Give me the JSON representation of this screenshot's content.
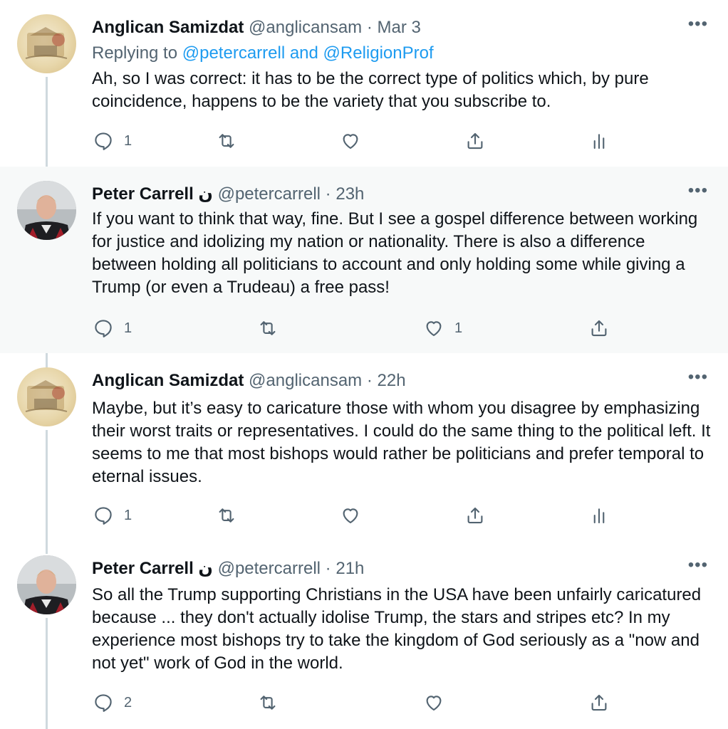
{
  "tweets": [
    {
      "name": "Anglican Samizdat",
      "handle": "@anglicansam",
      "dot": "·",
      "time": "Mar 3",
      "replying_prefix": "Replying to",
      "replying_link": "@petercarrell and @ReligionProf",
      "text": "Ah, so I was correct: it has to be the correct type of politics which, by pure coincidence, happens to be the variety that you subscribe to.",
      "reply_count": "1",
      "like_count": ""
    },
    {
      "name": "Peter Carrell",
      "name_suffix": "ن",
      "handle": "@petercarrell",
      "dot": "·",
      "time": "23h",
      "text": "If you want to think that way, fine. But I see a gospel difference between working for justice and idolizing my nation or nationality. There is also a difference between holding all politicians to account and only holding some while giving a Trump (or even a Trudeau) a free pass!",
      "reply_count": "1",
      "like_count": "1"
    },
    {
      "name": "Anglican Samizdat",
      "handle": "@anglicansam",
      "dot": "·",
      "time": "22h",
      "text": "Maybe, but it’s easy to caricature those with whom you disagree by emphasizing their worst traits or representatives. I could do the same thing to the political left. It seems to me that most bishops would rather be politicians and prefer temporal to eternal issues.",
      "reply_count": "1",
      "like_count": ""
    },
    {
      "name": "Peter Carrell",
      "name_suffix": "ن",
      "handle": "@petercarrell",
      "dot": "·",
      "time": "21h",
      "text": "So all the Trump supporting Christians in the USA have been unfairly caricatured because ... they don't actually idolise Trump, the stars and stripes etc? In my experience most bishops try to take the kingdom of God seriously as a \"now and not yet\" work of God in the world.",
      "reply_count": "2",
      "like_count": ""
    }
  ],
  "icons": {
    "more": "more-options-icon",
    "reply": "reply-icon",
    "retweet": "retweet-icon",
    "like": "like-icon",
    "share": "share-icon",
    "analytics": "analytics-icon"
  },
  "colors": {
    "link": "#1d9bf0",
    "secondary_text": "#536471",
    "highlight_bg": "#f7f9f9",
    "thread_line": "#cfd9de"
  }
}
